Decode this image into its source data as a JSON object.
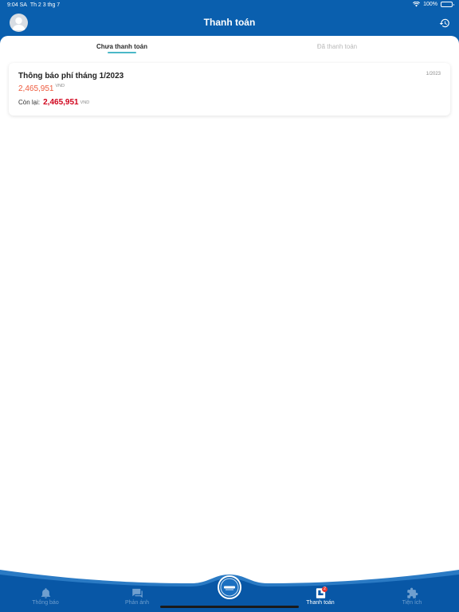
{
  "status_bar": {
    "time": "9:04 SA",
    "date": "Th 2 3 thg 7",
    "battery": "100%"
  },
  "header": {
    "title": "Thanh toán",
    "right_icon": "history-icon"
  },
  "tabs": [
    {
      "label": "Chưa thanh toán",
      "active": true
    },
    {
      "label": "Đã thanh toán",
      "active": false
    }
  ],
  "bills": [
    {
      "title": "Thông báo phí tháng 1/2023",
      "period": "1/2023",
      "amount": "2,465,951",
      "currency": "VND",
      "remaining_label": "Còn lại:",
      "remaining_amount": "2,465,951"
    }
  ],
  "tabbar": {
    "items": [
      {
        "label": "Thông báo",
        "icon": "bell-icon"
      },
      {
        "label": "Phản ánh",
        "icon": "chat-icon"
      },
      {
        "label": "Thanh toán",
        "icon": "receipt-icon",
        "badge": "2"
      },
      {
        "label": "Tiện ích",
        "icon": "puzzle-icon"
      }
    ],
    "center_icon": "home-logo-icon"
  },
  "colors": {
    "primary": "#0a5fae",
    "tabbar": "#0857a6",
    "accent_amount": "#ee5a3d",
    "remaining": "#d0021b",
    "tab_indicator": "#4bb8c7"
  }
}
